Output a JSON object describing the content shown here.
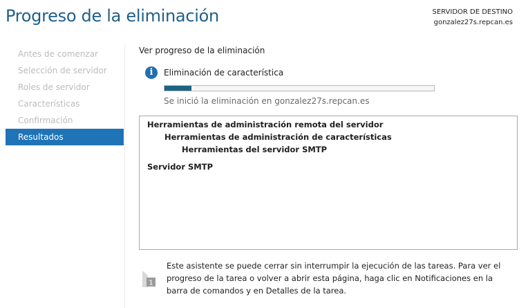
{
  "header": {
    "title": "Progreso de la eliminación",
    "dest_label": "SERVIDOR DE DESTINO",
    "dest_server": "gonzalez27s.repcan.es"
  },
  "nav": {
    "items": [
      {
        "label": "Antes de comenzar",
        "active": false
      },
      {
        "label": "Selección de servidor",
        "active": false
      },
      {
        "label": "Roles de servidor",
        "active": false
      },
      {
        "label": "Características",
        "active": false
      },
      {
        "label": "Confirmación",
        "active": false
      },
      {
        "label": "Resultados",
        "active": true
      }
    ]
  },
  "main": {
    "heading": "Ver progreso de la eliminación",
    "status_title": "Eliminación de característica",
    "progress": 0.1,
    "status_text": "Se inició la eliminación en gonzalez27s.repcan.es",
    "results": [
      "Herramientas de administración remota del servidor",
      "Herramientas de administración de características",
      "Herramientas del servidor SMTP",
      "Servidor SMTP"
    ],
    "note": "Este asistente se puede cerrar sin interrumpir la ejecución de las tareas. Para ver el progreso de la tarea o volver a abrir esta página, haga clic en Notificaciones en la barra de comandos y en Detalles de la tarea.",
    "note_icon_number": "1"
  },
  "colors": {
    "accent": "#1f74b8",
    "title": "#1f5f8b",
    "progress_fill": "#1c6384"
  },
  "icons": {
    "status": "info-icon",
    "note": "notification-flag-icon"
  }
}
